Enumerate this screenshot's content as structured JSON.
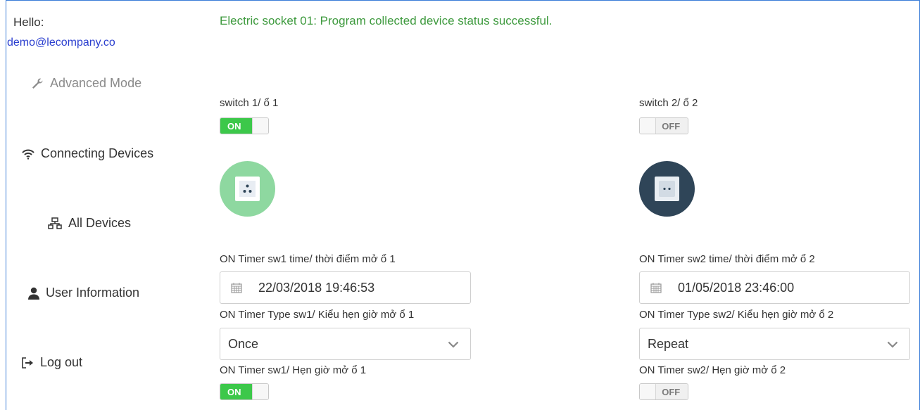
{
  "sidebar": {
    "hello": "Hello:",
    "email": "demo@lecompany.co",
    "items": [
      {
        "label": "Advanced Mode",
        "icon": "wrench-icon"
      },
      {
        "label": "Connecting Devices",
        "icon": "wifi-icon"
      },
      {
        "label": "All Devices",
        "icon": "network-icon"
      },
      {
        "label": "User Information",
        "icon": "user-icon"
      },
      {
        "label": "Log out",
        "icon": "logout-icon"
      }
    ]
  },
  "status_message": "Electric socket 01: Program collected device status successful.",
  "colors": {
    "success": "#3e9a3e",
    "toggle_on": "#3cc84a",
    "socket_on": "#8ed8a0",
    "socket_off": "#2f4558"
  },
  "sockets": [
    {
      "switch_label": "switch 1/ ổ 1",
      "switch_state": "ON",
      "timer_time_label": "ON Timer sw1 time/ thời điểm mở ổ 1",
      "timer_time_value": "22/03/2018 19:46:53",
      "timer_type_label": "ON Timer Type sw1/ Kiểu hẹn giờ mở ổ 1",
      "timer_type_value": "Once",
      "timer_enable_label": "ON Timer sw1/ Hẹn giờ mở ổ 1",
      "timer_enable_state": "ON"
    },
    {
      "switch_label": "switch 2/ ổ 2",
      "switch_state": "OFF",
      "timer_time_label": "ON Timer sw2 time/ thời điểm mở ổ 2",
      "timer_time_value": "01/05/2018 23:46:00",
      "timer_type_label": "ON Timer Type sw2/ Kiểu hẹn giờ mở ổ 2",
      "timer_type_value": "Repeat",
      "timer_enable_label": "ON Timer sw2/ Hẹn giờ mở ổ 2",
      "timer_enable_state": "OFF"
    }
  ]
}
